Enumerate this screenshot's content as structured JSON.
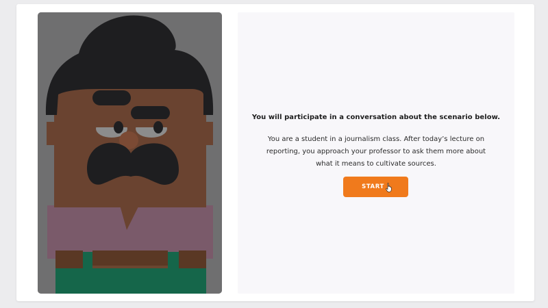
{
  "scenario": {
    "instruction": "You will participate in a conversation about the scenario below.",
    "text": "You are a student in a journalism class. After today’s lecture on reporting, you approach your professor to ask them more about what it means to cultivate sources.",
    "start_label": "START"
  },
  "character": {
    "icon": "character-illustration",
    "colors": {
      "overlay": "#6f6f70",
      "skin": "#6a4330",
      "hair": "#1e1e20",
      "shirt": "#7a5a6a",
      "overalls": "#15664a",
      "belt": "#5a3824"
    }
  },
  "colors": {
    "accent": "#f07a1c",
    "panel_background": "#f8f7fa",
    "page_background": "#ececee"
  }
}
